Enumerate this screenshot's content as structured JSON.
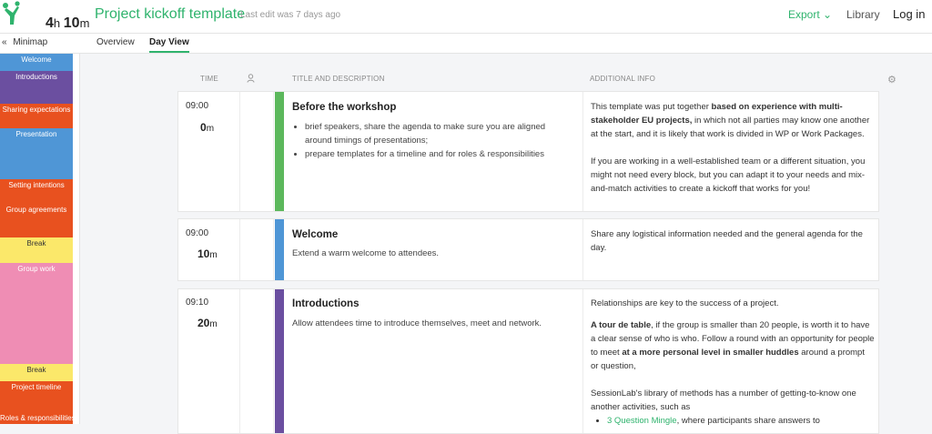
{
  "header": {
    "logo_icon": "sessionlab-figure-icon",
    "duration_hours": "4",
    "duration_hours_unit": "h",
    "duration_minutes": "10",
    "duration_minutes_unit": "m",
    "title": "Project kickoff template",
    "last_edit": "Last edit was 7 days ago",
    "export_label": "Export",
    "library_label": "Library",
    "login_label": "Log in"
  },
  "subheader": {
    "minimap_label": "Minimap",
    "tabs": [
      {
        "label": "Overview",
        "active": false
      },
      {
        "label": "Day View",
        "active": true
      }
    ]
  },
  "minimap": [
    {
      "label": "Welcome",
      "color": "#4f96d6"
    },
    {
      "label": "Introductions",
      "color": "#6b4fa0"
    },
    {
      "label": "Sharing expectations",
      "color": "#e8511f"
    },
    {
      "label": "Presentation",
      "color": "#4f96d6"
    },
    {
      "label": "Setting intentions",
      "color": "#e8511f"
    },
    {
      "label": "Group agreements",
      "color": "#e8511f"
    },
    {
      "label": "Break",
      "color": "#fbe86a"
    },
    {
      "label": "Group work",
      "color": "#ef8db4"
    },
    {
      "label": "Break",
      "color": "#fbe86a"
    },
    {
      "label": "Project timeline",
      "color": "#e8511f"
    },
    {
      "label": "Roles & responsibilities",
      "color": "#e8511f"
    }
  ],
  "table_header": {
    "time": "TIME",
    "title": "TITLE AND DESCRIPTION",
    "additional": "ADDITIONAL INFO"
  },
  "blocks": [
    {
      "start": "09:00",
      "duration": "0",
      "unit": "m",
      "color": "#5cb85c",
      "title": "Before the workshop",
      "bullets": [
        "brief speakers, share the agenda to make sure you are aligned around timings of presentations;",
        "prepare templates for a timeline and for roles & responsibilities"
      ],
      "info_p1_a": "This template was put together ",
      "info_p1_b": "based on experience with multi-stakeholder EU projects,",
      "info_p1_c": " in which not all parties may know one another at the start, and it is likely that work is divided in WP or Work Packages.",
      "info_p2": "If you are working in a well-established team or a different situation, you might not need every block, but you can adapt it to your needs and mix-and-match activities to create a kickoff that works for you!"
    },
    {
      "start": "09:00",
      "duration": "10",
      "unit": "m",
      "color": "#4f96d6",
      "title": "Welcome",
      "desc": "Extend a warm welcome to attendees.",
      "info": "Share any logistical information needed and the general agenda for the day."
    },
    {
      "start": "09:10",
      "duration": "20",
      "unit": "m",
      "color": "#6b4fa0",
      "title": "Introductions",
      "desc": "Allow attendees time to introduce themselves, meet and network.",
      "info_p1": "Relationships are key to the success of a project.",
      "info_p2_a": "A tour de table",
      "info_p2_b": ", if the group is smaller than 20 people, is worth it to have a clear sense of who is who. Follow a round with an opportunity for people to meet ",
      "info_p2_c": "at a more personal level in smaller huddles",
      "info_p2_d": " around a prompt or question,",
      "info_p3": "SessionLab's library of methods has a number of getting-to-know one another activities, such as",
      "info_link": "3 Question Mingle",
      "info_link_rest": ", where participants share answers to"
    }
  ]
}
